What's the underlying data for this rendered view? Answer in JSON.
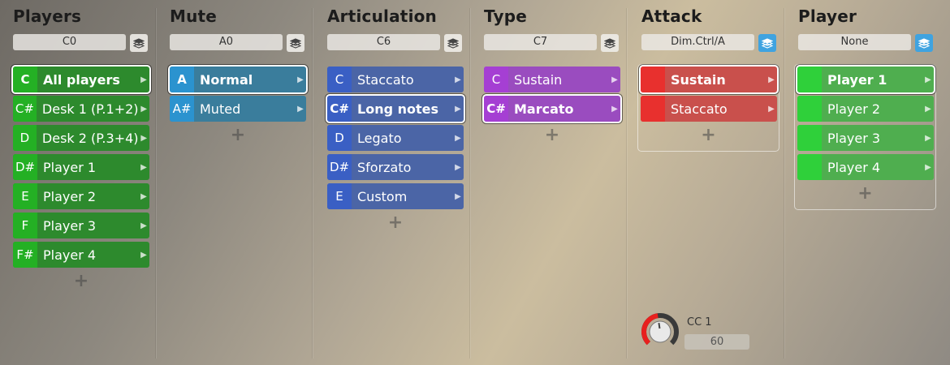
{
  "columns": [
    {
      "title": "Players",
      "selector": "C0",
      "layer_active": false,
      "framed": false,
      "key_color": "#24b024",
      "label_color": "#2d8a2d",
      "items": [
        {
          "key": "C",
          "label": "All players",
          "selected": true
        },
        {
          "key": "C#",
          "label": "Desk 1 (P.1+2)",
          "selected": false
        },
        {
          "key": "D",
          "label": "Desk 2 (P.3+4)",
          "selected": false
        },
        {
          "key": "D#",
          "label": "Player 1",
          "selected": false
        },
        {
          "key": "E",
          "label": "Player 2",
          "selected": false
        },
        {
          "key": "F",
          "label": "Player 3",
          "selected": false
        },
        {
          "key": "F#",
          "label": "Player 4",
          "selected": false
        }
      ],
      "add_label": "+"
    },
    {
      "title": "Mute",
      "selector": "A0",
      "layer_active": false,
      "framed": false,
      "key_color": "#2b93cf",
      "label_color": "#3a7d9c",
      "items": [
        {
          "key": "A",
          "label": "Normal",
          "selected": true
        },
        {
          "key": "A#",
          "label": "Muted",
          "selected": false
        }
      ],
      "add_label": "+"
    },
    {
      "title": "Articulation",
      "selector": "C6",
      "layer_active": false,
      "framed": false,
      "key_color": "#3a5fc4",
      "label_color": "#4b65a6",
      "items": [
        {
          "key": "C",
          "label": "Staccato",
          "selected": false
        },
        {
          "key": "C#",
          "label": "Long notes",
          "selected": true
        },
        {
          "key": "D",
          "label": "Legato",
          "selected": false
        },
        {
          "key": "D#",
          "label": "Sforzato",
          "selected": false
        },
        {
          "key": "E",
          "label": "Custom",
          "selected": false
        }
      ],
      "add_label": "+"
    },
    {
      "title": "Type",
      "selector": "C7",
      "layer_active": false,
      "framed": false,
      "key_color": "#a53fd3",
      "label_color": "#9a4cbf",
      "items": [
        {
          "key": "C",
          "label": "Sustain",
          "selected": false
        },
        {
          "key": "C#",
          "label": "Marcato",
          "selected": true
        }
      ],
      "add_label": "+"
    },
    {
      "title": "Attack",
      "selector": "Dim.Ctrl/A",
      "layer_active": true,
      "framed": true,
      "key_color": "#e8302e",
      "label_color": "#c9504c",
      "items": [
        {
          "key": "",
          "label": "Sustain",
          "selected": true
        },
        {
          "key": "",
          "label": "Staccato",
          "selected": false
        }
      ],
      "add_label": "+"
    },
    {
      "title": "Player",
      "selector": "None",
      "layer_active": true,
      "framed": true,
      "key_color": "#2fd03a",
      "label_color": "#4fae4f",
      "items": [
        {
          "key": "",
          "label": "Player 1",
          "selected": true
        },
        {
          "key": "",
          "label": "Player 2",
          "selected": false
        },
        {
          "key": "",
          "label": "Player 3",
          "selected": false
        },
        {
          "key": "",
          "label": "Player 4",
          "selected": false
        }
      ],
      "add_label": "+"
    }
  ],
  "cc": {
    "label": "CC 1",
    "value": "60",
    "fraction": 0.47,
    "arc_color": "#e8201e"
  }
}
